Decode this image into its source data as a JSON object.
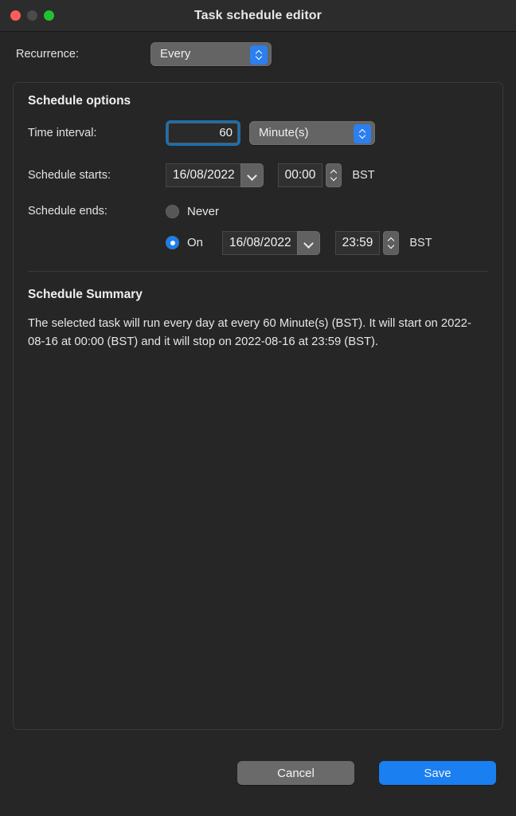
{
  "window": {
    "title": "Task schedule editor",
    "traffic_lights": [
      {
        "name": "close",
        "color": "#fc5f57"
      },
      {
        "name": "minimize",
        "color": "#4b4b4b"
      },
      {
        "name": "zoom",
        "color": "#21c231"
      }
    ]
  },
  "recurrence": {
    "label": "Recurrence:",
    "value": "Every",
    "options": [
      "Every"
    ]
  },
  "schedule_options": {
    "title": "Schedule options",
    "time_interval": {
      "label": "Time interval:",
      "value": "60",
      "unit": "Minute(s)",
      "unit_options": [
        "Minute(s)"
      ]
    },
    "starts": {
      "label": "Schedule starts:",
      "date": "16/08/2022",
      "time": "00:00",
      "timezone": "BST"
    },
    "ends": {
      "label": "Schedule ends:",
      "never_label": "Never",
      "never_selected": false,
      "on_label": "On",
      "on_selected": true,
      "date": "16/08/2022",
      "time": "23:59",
      "timezone": "BST"
    }
  },
  "summary": {
    "title": "Schedule Summary",
    "text": "The selected task will run every day at every 60 Minute(s) (BST). It will start on 2022-08-16 at 00:00 (BST) and it will stop on 2022-08-16 at 23:59 (BST)."
  },
  "footer": {
    "cancel_label": "Cancel",
    "save_label": "Save",
    "save_color": "#1a7ff0"
  }
}
